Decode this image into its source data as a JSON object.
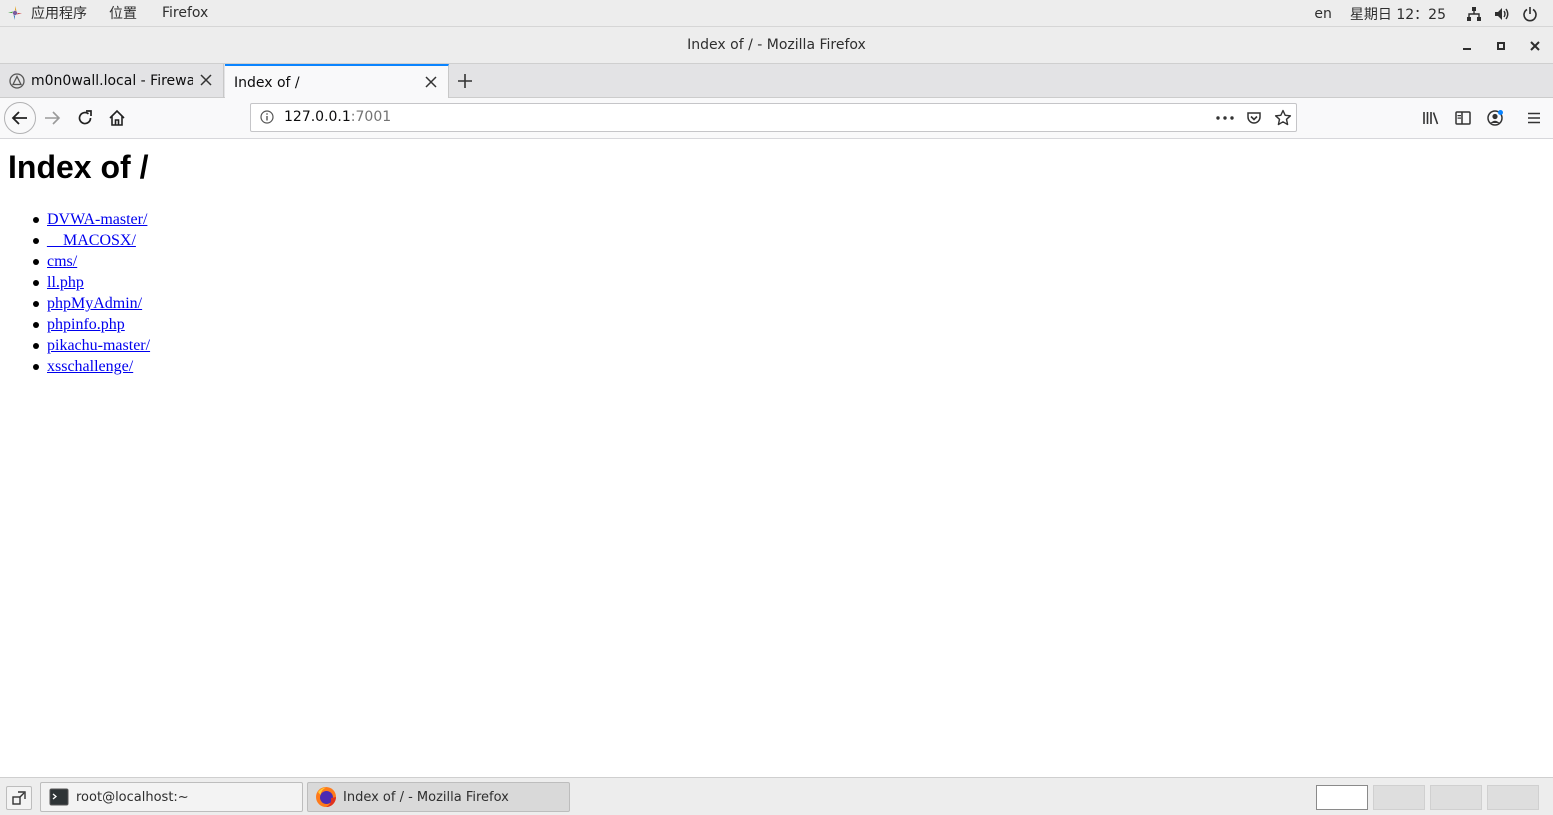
{
  "topbar": {
    "applications_label": "应用程序",
    "places_label": "位置",
    "app_label": "Firefox",
    "language": "en",
    "datetime": "星期日 12：25"
  },
  "window": {
    "title": "Index of / - Mozilla Firefox"
  },
  "tabs": [
    {
      "label": "m0n0wall.local - Firewall: ",
      "active": false
    },
    {
      "label": "Index of /",
      "active": true
    }
  ],
  "urlbar": {
    "host": "127.0.0.1",
    "port": ":7001"
  },
  "page": {
    "title": "Index of /",
    "entries": [
      "DVWA-master/",
      "__MACOSX/",
      "cms/",
      "ll.php",
      "phpMyAdmin/",
      "phpinfo.php",
      "pikachu-master/",
      "xsschallenge/"
    ]
  },
  "taskbar": {
    "items": [
      {
        "label": "root@localhost:~",
        "icon": "terminal-icon"
      },
      {
        "label": "Index of / - Mozilla Firefox",
        "icon": "firefox-icon"
      }
    ]
  },
  "colors": {
    "accent": "#0a84ff",
    "link": "#0000ee"
  }
}
